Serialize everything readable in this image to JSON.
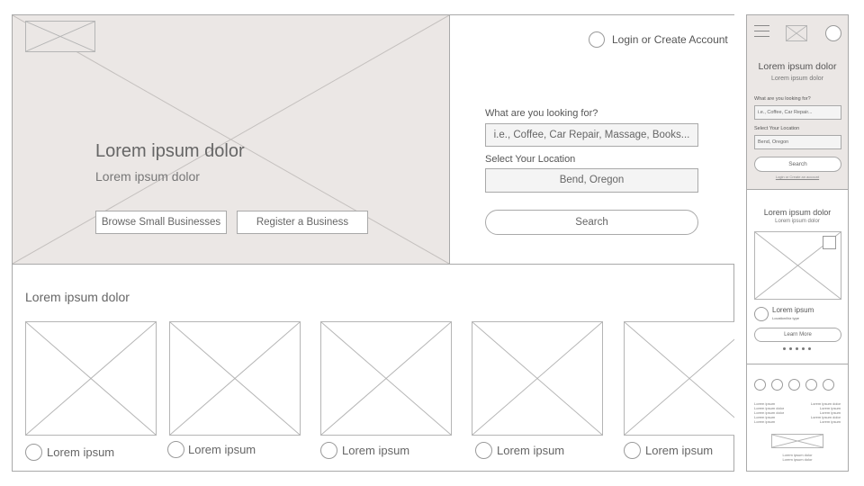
{
  "desktop": {
    "header": {
      "login_text": "Login or Create Account"
    },
    "hero": {
      "title": "Lorem ipsum dolor",
      "subtitle": "Lorem ipsum dolor",
      "browse_button": "Browse Small Businesses",
      "register_button": "Register a Business"
    },
    "search": {
      "looking_label": "What are you looking for?",
      "looking_placeholder": "i.e., Coffee, Car Repair, Massage, Books...",
      "location_label": "Select Your Location",
      "location_value": "Bend, Oregon",
      "search_button": "Search"
    },
    "featured": {
      "title": "Lorem ipsum dolor",
      "cards": [
        {
          "label": "Lorem ipsum"
        },
        {
          "label": "Lorem ipsum"
        },
        {
          "label": "Lorem ipsum"
        },
        {
          "label": "Lorem ipsum"
        },
        {
          "label": "Lorem ipsum"
        }
      ]
    }
  },
  "mobile": {
    "header": {
      "title": "Lorem ipsum dolor",
      "subtitle": "Lorem ipsum dolor"
    },
    "search": {
      "looking_label": "What are you looking for?",
      "looking_placeholder": "i.e., Coffee, Car Repair...",
      "location_label": "Select Your Location",
      "location_value": "Bend, Oregon",
      "search_button": "Search",
      "login_text": "Login or Create an account"
    },
    "card": {
      "title": "Lorem ipsum dolor",
      "subtitle": "Lorem ipsum dolor",
      "name": "Lorem ipsum",
      "type": "Location/biz type",
      "learn_more": "Learn More"
    },
    "footer": {
      "links_left": [
        "Lorem ipsum",
        "Lorem ipsum dolor",
        "Lorem ipsum dolor",
        "Lorem ipsum",
        "Lorem ipsum"
      ],
      "links_right": [
        "Lorem ipsum dolor",
        "Lorem ipsum",
        "Lorem ipsum",
        "Lorem ipsum dolor",
        "Lorem ipsum"
      ],
      "text_line1": "Lorem ipsum dolor",
      "text_line2": "Lorem ipsum dolor"
    }
  },
  "colors": {
    "hero_background": "#ebe7e5",
    "border": "#a9a9a9",
    "text": "#555555"
  },
  "icons": {
    "placeholder_image": "x-image-placeholder-icon",
    "menu": "hamburger-menu-icon",
    "avatar": "user-circle-icon"
  }
}
